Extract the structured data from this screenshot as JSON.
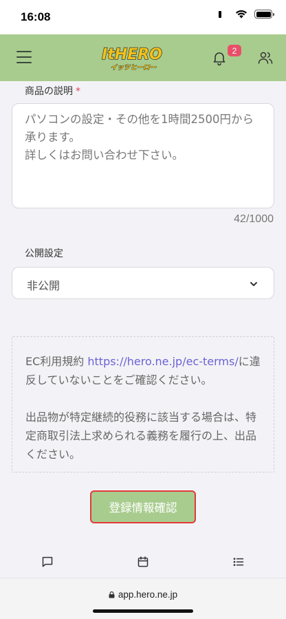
{
  "status_bar": {
    "time": "16:08"
  },
  "header": {
    "logo_text": "ItHERO",
    "logo_subtext": "イッツヒーロー",
    "notification_count": "2"
  },
  "description": {
    "label": "商品の説明",
    "required_mark": "*",
    "value": "パソコンの設定・その他を1時間2500円から承ります。\n詳しくはお問い合わせ下さい。",
    "char_count": "42/1000"
  },
  "visibility": {
    "label": "公開設定",
    "selected": "非公開"
  },
  "notice": {
    "prefix": "EC利用規約 ",
    "link": "https://hero.ne.jp/ec-terms/",
    "line1_suffix": "に違反していないことをご確認ください。",
    "paragraph2": "出品物が特定継続的役務に該当する場合は、特定商取引法上求められる義務を履行の上、出品ください。"
  },
  "confirm_button": {
    "label": "登録情報確認"
  },
  "browser": {
    "url": "app.hero.ne.jp"
  },
  "colors": {
    "header_green": "#a8cc8e",
    "badge_pink": "#e8506a",
    "link_purple": "#6b62d4",
    "button_border_red": "#e23a3a"
  },
  "icons": [
    "menu-icon",
    "bell-icon",
    "users-icon",
    "chevron-down-icon",
    "chat-icon",
    "calendar-icon",
    "list-icon",
    "lock-icon"
  ]
}
